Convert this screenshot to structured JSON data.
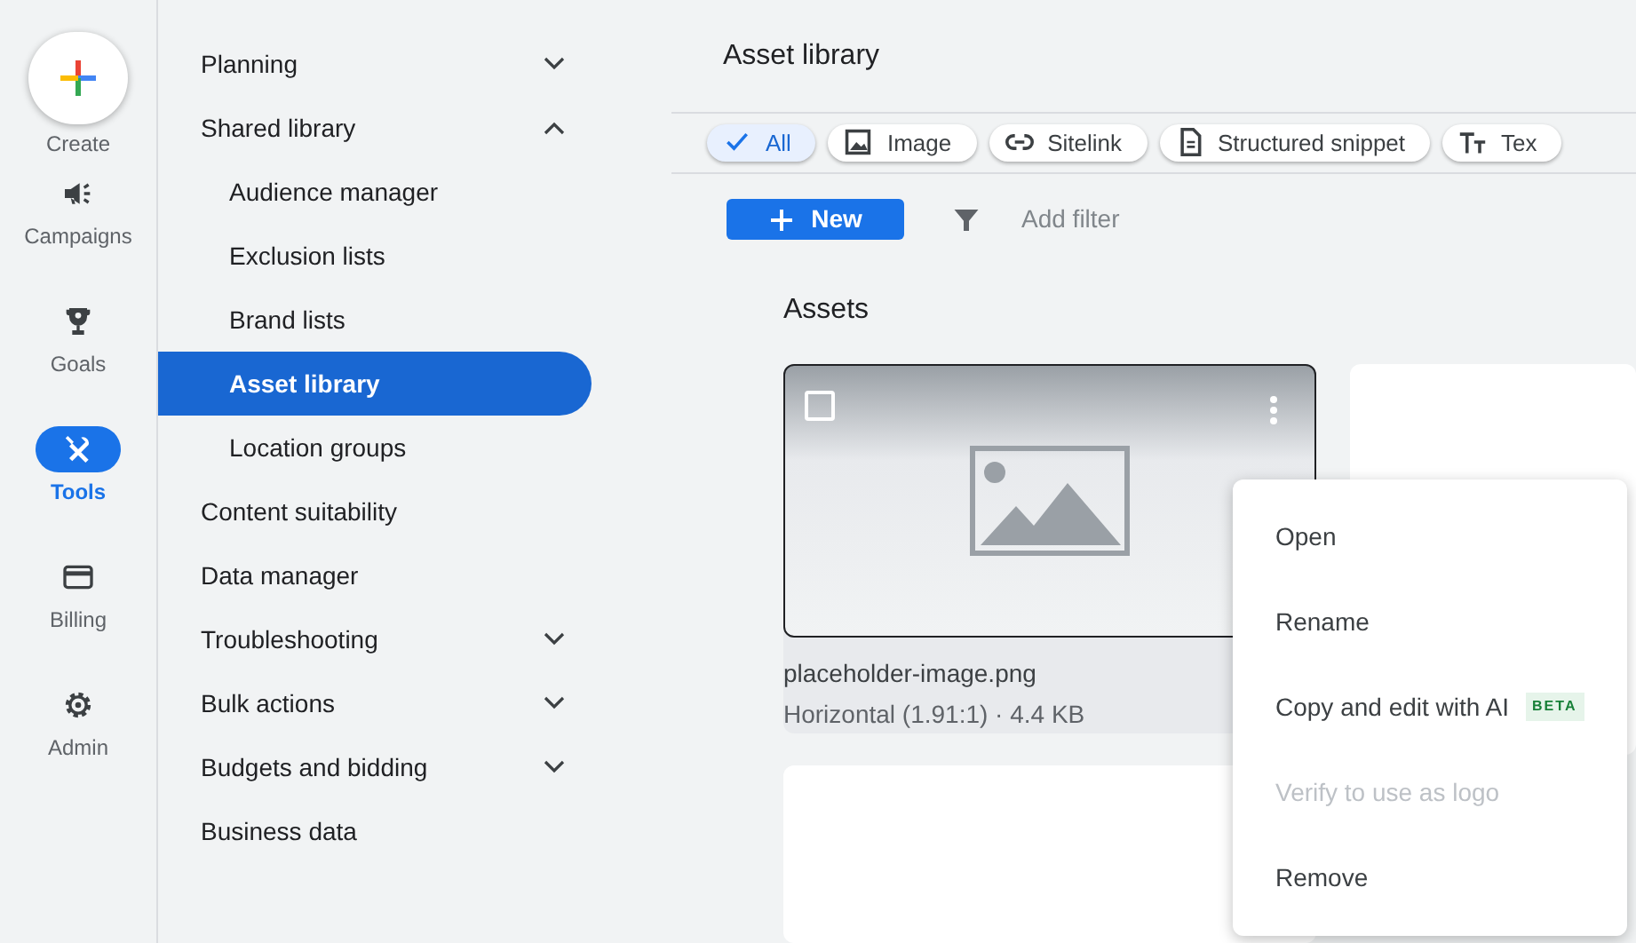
{
  "rail": [
    {
      "kind": "create",
      "label": "Create"
    },
    {
      "kind": "campaigns",
      "label": "Campaigns",
      "selected": false
    },
    {
      "kind": "goals",
      "label": "Goals",
      "selected": false
    },
    {
      "kind": "tools",
      "label": "Tools",
      "selected": true
    },
    {
      "kind": "billing",
      "label": "Billing",
      "selected": false
    },
    {
      "kind": "admin",
      "label": "Admin",
      "selected": false
    }
  ],
  "nav": [
    {
      "label": "Planning",
      "selected": false,
      "expanded": false
    },
    {
      "label": "Shared library",
      "selected": false,
      "expanded": true,
      "children": [
        {
          "label": "Audience manager",
          "selected": false
        },
        {
          "label": "Exclusion lists",
          "selected": false
        },
        {
          "label": "Brand lists",
          "selected": false
        },
        {
          "label": "Asset library",
          "selected": true
        },
        {
          "label": "Location groups",
          "selected": false
        }
      ]
    },
    {
      "label": "Content suitability",
      "selected": false
    },
    {
      "label": "Data manager",
      "selected": false
    },
    {
      "label": "Troubleshooting",
      "selected": false,
      "expanded": false
    },
    {
      "label": "Bulk actions",
      "selected": false,
      "expanded": false
    },
    {
      "label": "Budgets and bidding",
      "selected": false,
      "expanded": false
    },
    {
      "label": "Business data",
      "selected": false
    }
  ],
  "page_title": "Asset library",
  "chips": [
    {
      "kind": "all",
      "label": "All",
      "selected": true
    },
    {
      "kind": "image",
      "label": "Image",
      "selected": false
    },
    {
      "kind": "sitelink",
      "label": "Sitelink",
      "selected": false
    },
    {
      "kind": "snippet",
      "label": "Structured snippet",
      "selected": false
    },
    {
      "kind": "text",
      "label": "Tex",
      "selected": false
    }
  ],
  "new_button": "New",
  "filter_placeholder": "Add filter",
  "section_title": "Assets",
  "assets": [
    {
      "name": "placeholder-image.png",
      "details": "Horizontal (1.91:1) · 4.4 KB",
      "checked": false
    }
  ],
  "menu": [
    {
      "label": "Open",
      "disabled": false
    },
    {
      "label": "Rename",
      "disabled": false
    },
    {
      "label": "Copy and edit with AI",
      "disabled": false,
      "badge": "BETA"
    },
    {
      "label": "Verify to use as logo",
      "disabled": true
    },
    {
      "label": "Remove",
      "disabled": false
    }
  ]
}
